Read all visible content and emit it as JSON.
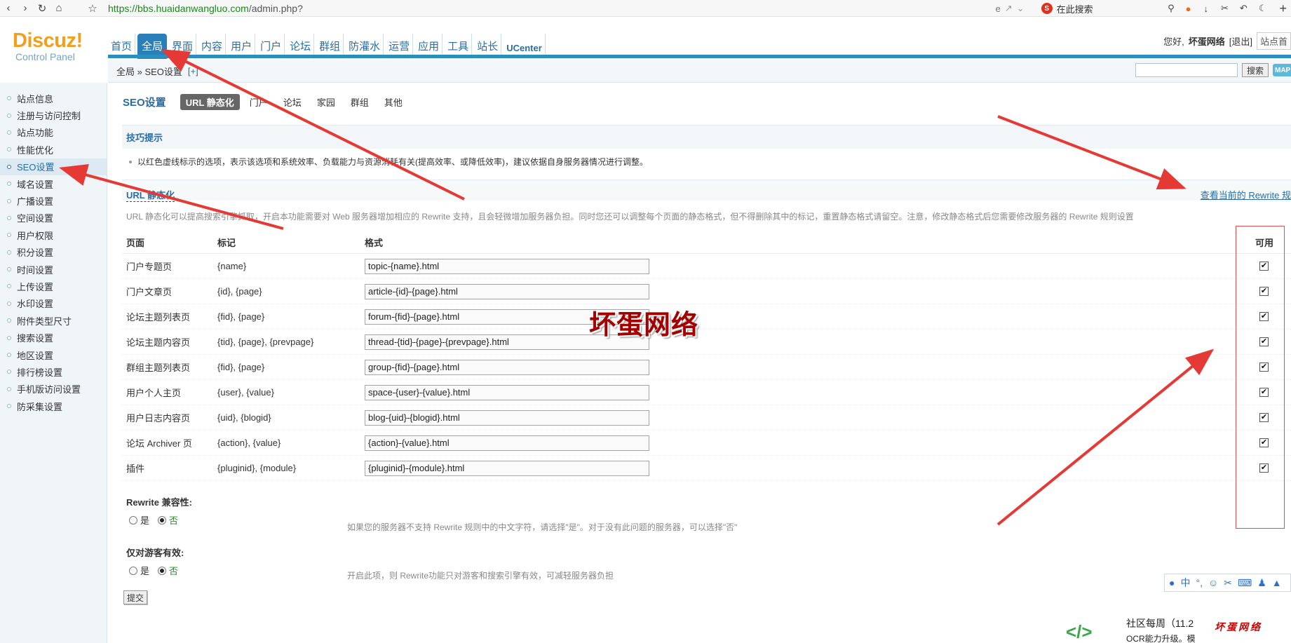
{
  "browser": {
    "url_host": "https://bbs.huaidanwangluo.com",
    "url_path": "/admin.php?",
    "search_placeholder": "在此搜索"
  },
  "header": {
    "logo_text": "Discuz!",
    "logo_sub": "Control Panel",
    "nav": [
      "首页",
      "全局",
      "界面",
      "内容",
      "用户",
      "门户",
      "论坛",
      "群组",
      "防灌水",
      "运营",
      "应用",
      "工具",
      "站长",
      "UCenter"
    ],
    "greeting": "您好,",
    "username": "坏蛋网络",
    "logout": "[退出]",
    "site_home": "站点首"
  },
  "breadcrumb": {
    "path": "全局 » SEO设置",
    "plus": "[+]",
    "search_button": "搜索",
    "map": "MAP"
  },
  "sidebar": {
    "items": [
      "站点信息",
      "注册与访问控制",
      "站点功能",
      "性能优化",
      "SEO设置",
      "域名设置",
      "广播设置",
      "空间设置",
      "用户权限",
      "积分设置",
      "时间设置",
      "上传设置",
      "水印设置",
      "附件类型尺寸",
      "搜索设置",
      "地区设置",
      "排行榜设置",
      "手机版访问设置",
      "防采集设置"
    ],
    "active": "SEO设置"
  },
  "tabs": {
    "title": "SEO设置",
    "items": [
      "URL 静态化",
      "门户",
      "论坛",
      "家园",
      "群组",
      "其他"
    ]
  },
  "tips": {
    "heading": "技巧提示",
    "text": "以红色虚线标示的选项，表示该选项和系统效率、负载能力与资源消耗有关(提高效率、或降低效率)，建议依据自身服务器情况进行调整。"
  },
  "url_section": {
    "heading": "URL 静态化",
    "rewrite_link": "查看当前的 Rewrite 规",
    "description": "URL 静态化可以提高搜索引擎抓取，开启本功能需要对 Web 服务器增加相应的 Rewrite 支持，且会轻微增加服务器负担。同时您还可以调整每个页面的静态格式，但不得删除其中的标记，重置静态格式请留空。注意，修改静态格式后您需要修改服务器的 Rewrite 规则设置"
  },
  "table": {
    "headers": [
      "页面",
      "标记",
      "格式",
      "可用"
    ],
    "rows": [
      {
        "page": "门户专题页",
        "tags": "{name}",
        "format": "topic-{name}.html",
        "enabled": "✔"
      },
      {
        "page": "门户文章页",
        "tags": "{id}, {page}",
        "format": "article-{id}-{page}.html",
        "enabled": "✔"
      },
      {
        "page": "论坛主题列表页",
        "tags": "{fid}, {page}",
        "format": "forum-{fid}-{page}.html",
        "enabled": "✔"
      },
      {
        "page": "论坛主题内容页",
        "tags": "{tid}, {page}, {prevpage}",
        "format": "thread-{tid}-{page}-{prevpage}.html",
        "enabled": "✔"
      },
      {
        "page": "群组主题列表页",
        "tags": "{fid}, {page}",
        "format": "group-{fid}-{page}.html",
        "enabled": "✔"
      },
      {
        "page": "用户个人主页",
        "tags": "{user}, {value}",
        "format": "space-{user}-{value}.html",
        "enabled": "✔"
      },
      {
        "page": "用户日志内容页",
        "tags": "{uid}, {blogid}",
        "format": "blog-{uid}-{blogid}.html",
        "enabled": "✔"
      },
      {
        "page": "论坛 Archiver 页",
        "tags": "{action}, {value}",
        "format": "{action}-{value}.html",
        "enabled": "✔"
      },
      {
        "page": "插件",
        "tags": "{pluginid}, {module}",
        "format": "{pluginid}-{module}.html",
        "enabled": "✔"
      }
    ]
  },
  "options": {
    "rewrite_compat": {
      "label": "Rewrite 兼容性:",
      "yes": "是",
      "no": "否",
      "selected": "否",
      "desc": "如果您的服务器不支持 Rewrite 规则中的中文字符，请选择\"是\"。对于没有此问题的服务器，可以选择\"否\""
    },
    "guest_only": {
      "label": "仅对游客有效:",
      "yes": "是",
      "no": "否",
      "selected": "否",
      "desc": "开启此项，则 Rewrite功能只对游客和搜索引擎有效，可减轻服务器负担"
    },
    "submit": "提交"
  },
  "overlay": {
    "watermark": "坏蛋网络",
    "bottom_title": "社区每周（11.2",
    "bottom_sub": "OCR能力升级。模",
    "bottom_brand": "坏蛋网络"
  },
  "ime": {
    "lang": "中"
  },
  "colors": {
    "accent": "#2a7fb8",
    "arrow": "#e53935",
    "link": "#2b6ca3"
  }
}
